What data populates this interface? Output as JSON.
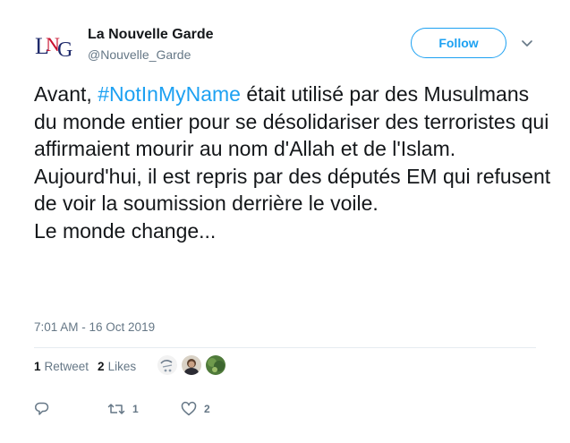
{
  "account": {
    "name": "La Nouvelle Garde",
    "handle": "@Nouvelle_Garde",
    "logo_letters": "LNG"
  },
  "follow_label": "Follow",
  "tweet": {
    "text_before": "Avant, ",
    "hashtag": "#NotInMyName",
    "text_after": " était utilisé par des Musulmans du monde entier pour se désolidariser des terroristes qui affirmaient mourir au nom d'Allah et de l'Islam.\nAujourd'hui, il est repris par des députés EM qui refusent de voir la soumission derrière le voile.\nLe monde change..."
  },
  "timestamp": "7:01 AM - 16 Oct 2019",
  "stats": {
    "retweets_count": "1",
    "retweets_label": "Retweet",
    "likes_count": "2",
    "likes_label": "Likes"
  },
  "actions": {
    "reply_count": "",
    "retweet_count": "1",
    "like_count": "2"
  },
  "colors": {
    "accent": "#1da1f2",
    "text": "#14171a",
    "secondary": "#657786",
    "logo_red": "#c8102e",
    "logo_blue": "#1f2a6b"
  },
  "icons": [
    "chevron-down-icon",
    "reply-icon",
    "retweet-icon",
    "heart-icon"
  ]
}
